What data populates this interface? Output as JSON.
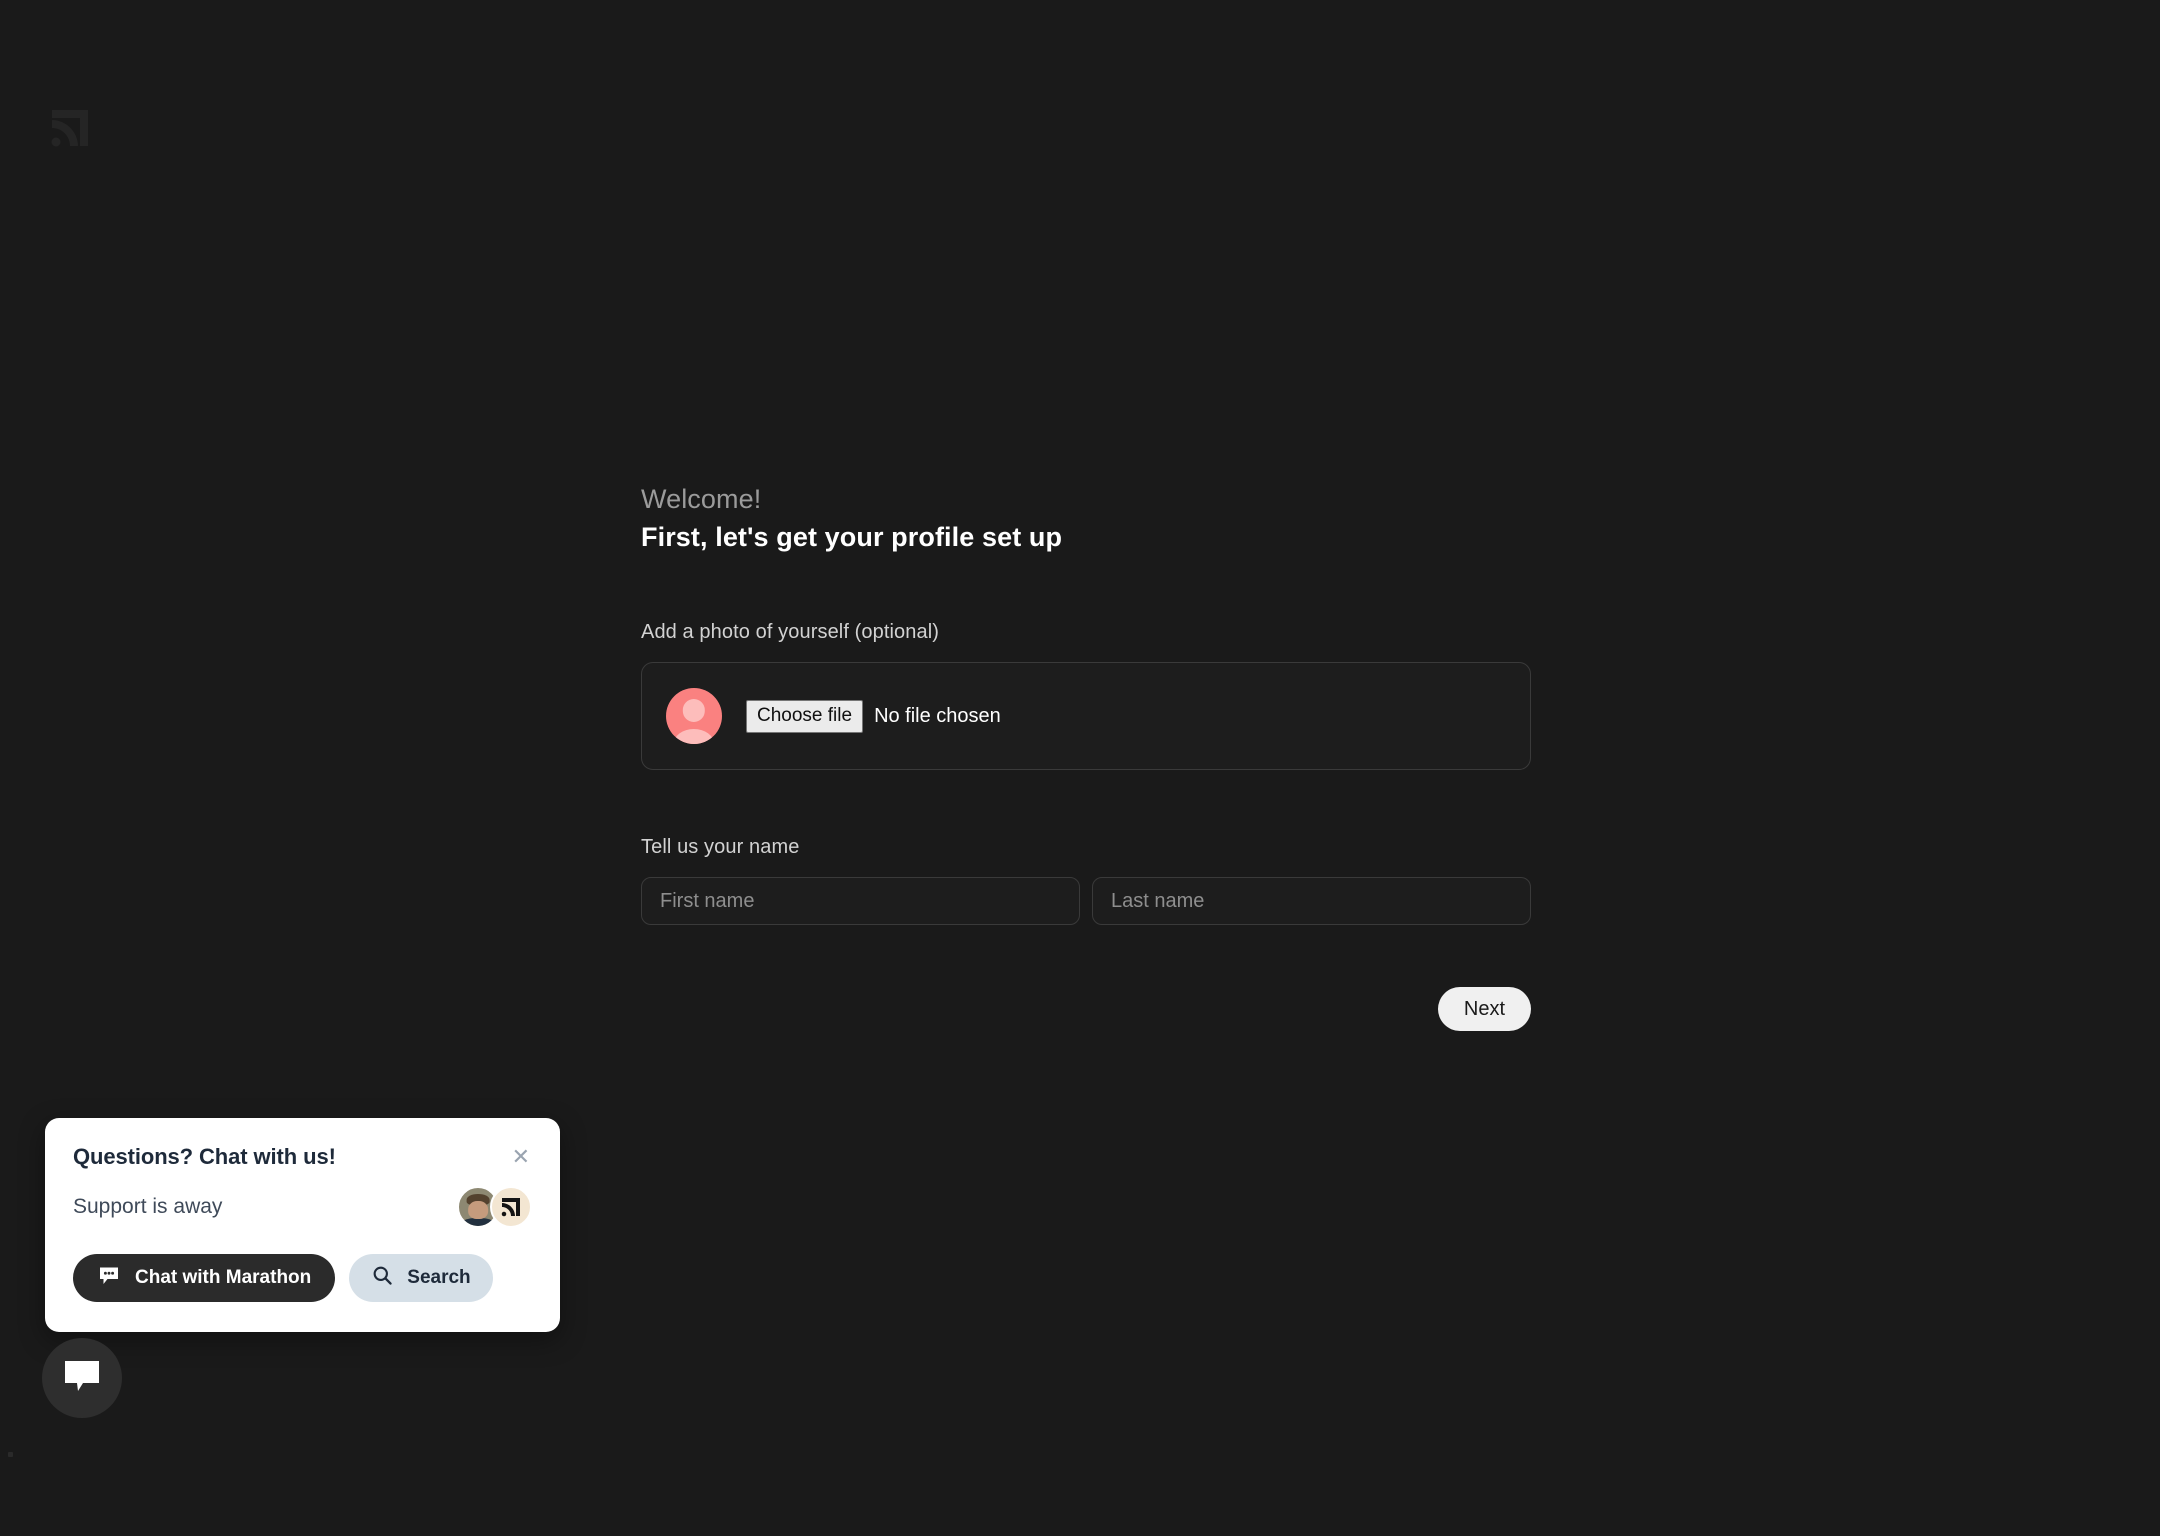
{
  "page": {
    "background_color": "#1a1a1a",
    "brand_logo_icon": "signal-logo-icon"
  },
  "onboarding": {
    "welcome_text": "Welcome!",
    "headline": "First, let's get your profile set up",
    "photo_label": "Add a photo of yourself (optional)",
    "file_input": {
      "button_label": "Choose file",
      "status_text": "No file chosen",
      "avatar_icon": "default-avatar-icon",
      "avatar_color": "#fa8180"
    },
    "name_label": "Tell us your name",
    "first_name": {
      "placeholder": "First name",
      "value": ""
    },
    "last_name": {
      "placeholder": "Last name",
      "value": ""
    },
    "next_label": "Next"
  },
  "chat_widget": {
    "title": "Questions? Chat with us!",
    "close_icon": "close-icon",
    "status": "Support is away",
    "avatars": [
      {
        "type": "agent-photo",
        "name": "support-agent-avatar"
      },
      {
        "type": "brand-logo",
        "name": "brand-avatar",
        "background": "#f3e6d2"
      }
    ],
    "chat_button": {
      "label": "Chat with Marathon",
      "icon": "chat-bubble-dots-icon",
      "background": "#2b2b2b"
    },
    "search_button": {
      "label": "Search",
      "icon": "search-icon",
      "background": "#d5dfe7"
    }
  },
  "launcher": {
    "icon": "chat-bubble-icon",
    "background": "#2e2e2e"
  }
}
